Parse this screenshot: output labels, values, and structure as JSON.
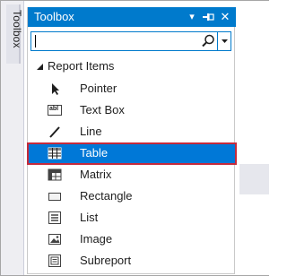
{
  "side_tab": {
    "label": "Toolbox"
  },
  "toolbox": {
    "title": "Toolbox",
    "buttons": [
      {
        "name": "dropdown-arrow-icon",
        "glyph": "▾"
      },
      {
        "name": "pin-icon",
        "glyph": "⊣"
      },
      {
        "name": "close-icon",
        "glyph": "✕"
      }
    ],
    "search": {
      "value": "",
      "placeholder": ""
    },
    "group": {
      "label": "Report Items",
      "expanded": true
    },
    "items": [
      {
        "label": "Pointer",
        "icon": "pointer-icon"
      },
      {
        "label": "Text Box",
        "icon": "textbox-icon",
        "icon_text": "abl"
      },
      {
        "label": "Line",
        "icon": "line-icon"
      },
      {
        "label": "Table",
        "icon": "table-icon",
        "selected": true
      },
      {
        "label": "Matrix",
        "icon": "matrix-icon"
      },
      {
        "label": "Rectangle",
        "icon": "rectangle-icon"
      },
      {
        "label": "List",
        "icon": "list-icon"
      },
      {
        "label": "Image",
        "icon": "image-icon"
      },
      {
        "label": "Subreport",
        "icon": "subreport-icon"
      }
    ]
  },
  "colors": {
    "accent": "#007acc",
    "selection": "#0078d7",
    "highlight_border": "#c42b3c",
    "text": "#1e1e1e"
  }
}
